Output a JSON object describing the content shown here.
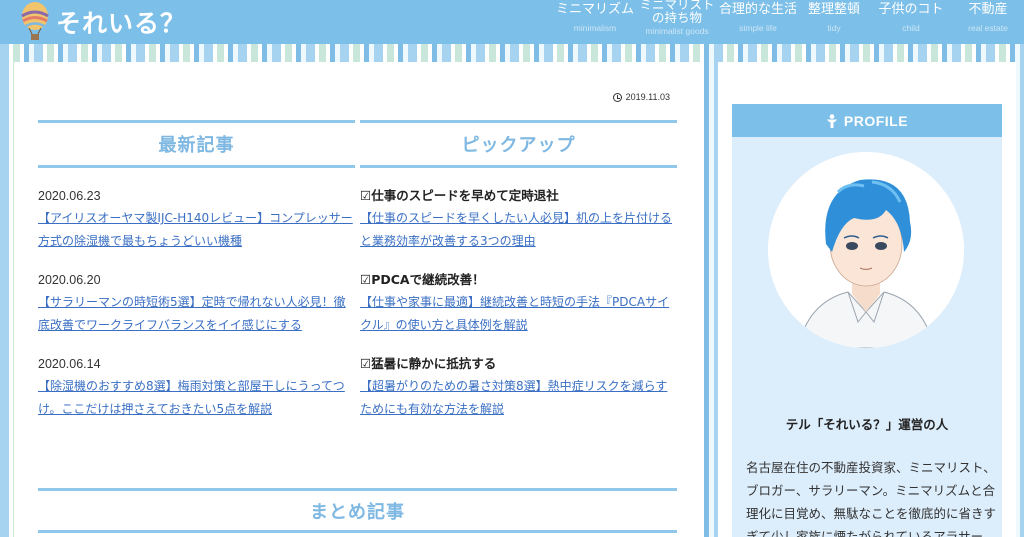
{
  "site": {
    "title": "それいる？"
  },
  "nav": [
    {
      "label": "ミニマリズム",
      "sub": "minimalism"
    },
    {
      "label": "ミニマリスト\nの持ち物",
      "sub": "minimalist goods"
    },
    {
      "label": "合理的な生活",
      "sub": "simple life"
    },
    {
      "label": "整理整頓",
      "sub": "tidy"
    },
    {
      "label": "子供のコト",
      "sub": "child"
    },
    {
      "label": "不動産",
      "sub": "real estate"
    }
  ],
  "post_date": "2019.11.03",
  "latest": {
    "heading": "最新記事",
    "items": [
      {
        "date": "2020.06.23",
        "title": "【アイリスオーヤマ製IJC-H140レビュー】コンプレッサー方式の除湿機で最もちょうどいい機種"
      },
      {
        "date": "2020.06.20",
        "title": "【サラリーマンの時短術5選】定時で帰れない人必見！徹底改善でワークライフバランスをイイ感じにする"
      },
      {
        "date": "2020.06.14",
        "title": "【除湿機のおすすめ8選】梅雨対策と部屋干しにうってつけ。ここだけは押さえておきたい5点を解説"
      }
    ]
  },
  "pickup": {
    "heading": "ピックアップ",
    "items": [
      {
        "title": "☑仕事のスピードを早めて定時退社",
        "link": "【仕事のスピードを早くしたい人必見】机の上を片付けると業務効率が改善する3つの理由"
      },
      {
        "title": "☑PDCAで継続改善！",
        "link": "【仕事や家事に最適】継続改善と時短の手法『PDCAサイクル』の使い方と具体例を解説"
      },
      {
        "title": "☑猛暑に静かに抵抗する",
        "link": "【超暑がりのための暑さ対策8選】熱中症リスクを減らすためにも有効な方法を解説"
      }
    ]
  },
  "summary_heading": "まとめ記事",
  "profile": {
    "header": "PROFILE",
    "name": "テル「それいる？」運営の人",
    "bio": "名古屋在住の不動産投資家、ミニマリスト、ブロガー、サラリーマン。ミニマリズムと合理化に目覚め、無駄なことを徹底的に省きすぎて少し家族に煙たがられているアラサー。"
  },
  "colors": {
    "header": "#7cbfe8",
    "heading_text": "#7fb8e2",
    "link": "#3a6fc4",
    "profile_bg": "#dcedfb"
  }
}
